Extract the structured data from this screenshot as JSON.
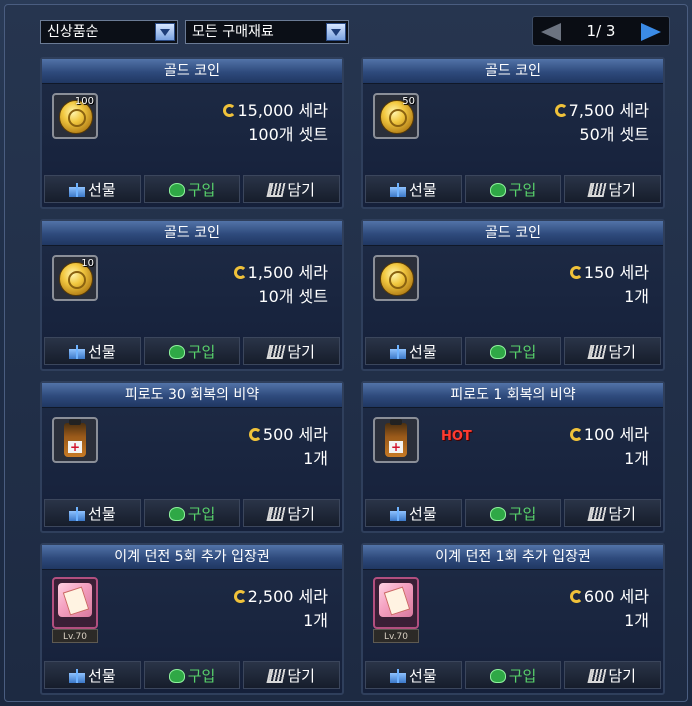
{
  "filters": {
    "grade_select": "신상품순",
    "category_select": "모든 구매재료"
  },
  "pagination": {
    "page_text": "1/ 3"
  },
  "buttons": {
    "gift": "선물",
    "buy": "구입",
    "cart": "담기"
  },
  "currency_unit": "세라",
  "items": [
    {
      "name": "골드 코인",
      "icon": "gold-coin-icon",
      "stack_badge": "100",
      "price": "15,000 세라",
      "quantity": "100개 셋트"
    },
    {
      "name": "골드 코인",
      "icon": "gold-coin-icon",
      "stack_badge": "50",
      "price": "7,500 세라",
      "quantity": "50개 셋트"
    },
    {
      "name": "골드 코인",
      "icon": "gold-coin-icon",
      "stack_badge": "10",
      "price": "1,500 세라",
      "quantity": "10개 셋트"
    },
    {
      "name": "골드 코인",
      "icon": "gold-coin-icon",
      "stack_badge": "",
      "price": "150 세라",
      "quantity": "1개"
    },
    {
      "name": "피로도 30 회복의 비약",
      "icon": "potion-icon",
      "price": "500 세라",
      "quantity": "1개"
    },
    {
      "name": "피로도 1 회복의 비약",
      "icon": "potion-icon",
      "badge": "HOT",
      "price": "100 세라",
      "quantity": "1개"
    },
    {
      "name": "이계 던전 5회 추가 입장권",
      "icon": "ticket-scroll-icon",
      "level": "Lv.70",
      "price": "2,500 세라",
      "quantity": "1개"
    },
    {
      "name": "이계 던전 1회 추가 입장권",
      "icon": "ticket-scroll-icon",
      "level": "Lv.70",
      "price": "600 세라",
      "quantity": "1개"
    }
  ],
  "colors": {
    "buy_text": "#58d26b",
    "hot_badge": "#ff3b30",
    "currency_icon": "#f0c23a",
    "next_arrow": "#3b8be6"
  }
}
